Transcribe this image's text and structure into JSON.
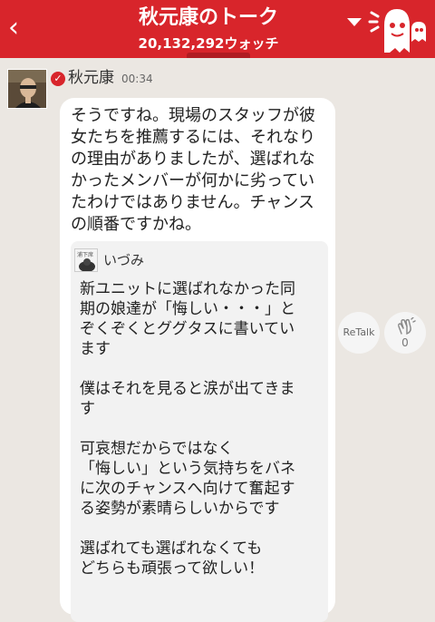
{
  "header": {
    "back_icon": "chevron-left-icon",
    "title": "秋元康のトーク",
    "watch_count": "20,132,292ウォッチ",
    "menu_icon": "dropdown-triangle-icon",
    "mascot_icon": "ghost-mascot-icon",
    "colors": {
      "bar": "#d8252b",
      "text": "#ffffff"
    }
  },
  "post": {
    "author": "秋元康",
    "time": "00:34",
    "verified_icon": "verified-check-icon",
    "message_lines": [
      "そうですね。現場のスタッフが彼",
      "女たちを推薦するには、それなり",
      "の理由がありましたが、選ばれな",
      "かったメンバーが何かに劣ってい",
      "たわけではありません。チャンス",
      "の順番ですかね。"
    ]
  },
  "quote": {
    "author": "いづみ",
    "avatar_label": "浦下席",
    "lines": [
      "新ユニットに選ばれなかった同",
      "期の娘達が「悔しい・・・」と",
      "ぞくぞくとググタスに書いてい",
      "ます",
      "",
      "僕はそれを見ると涙が出てきま",
      "す",
      "",
      "可哀想だからではなく",
      "「悔しい」という気持ちをバネ",
      "に次のチャンスへ向けて奮起す",
      "る姿勢が素晴らしいからです",
      "",
      "選ばれても選ばれなくても",
      "どちらも頑張って欲しい！"
    ]
  },
  "actions": {
    "retalk_label": "ReTalk",
    "like_icon": "clapping-hands-icon",
    "like_count": "0"
  }
}
